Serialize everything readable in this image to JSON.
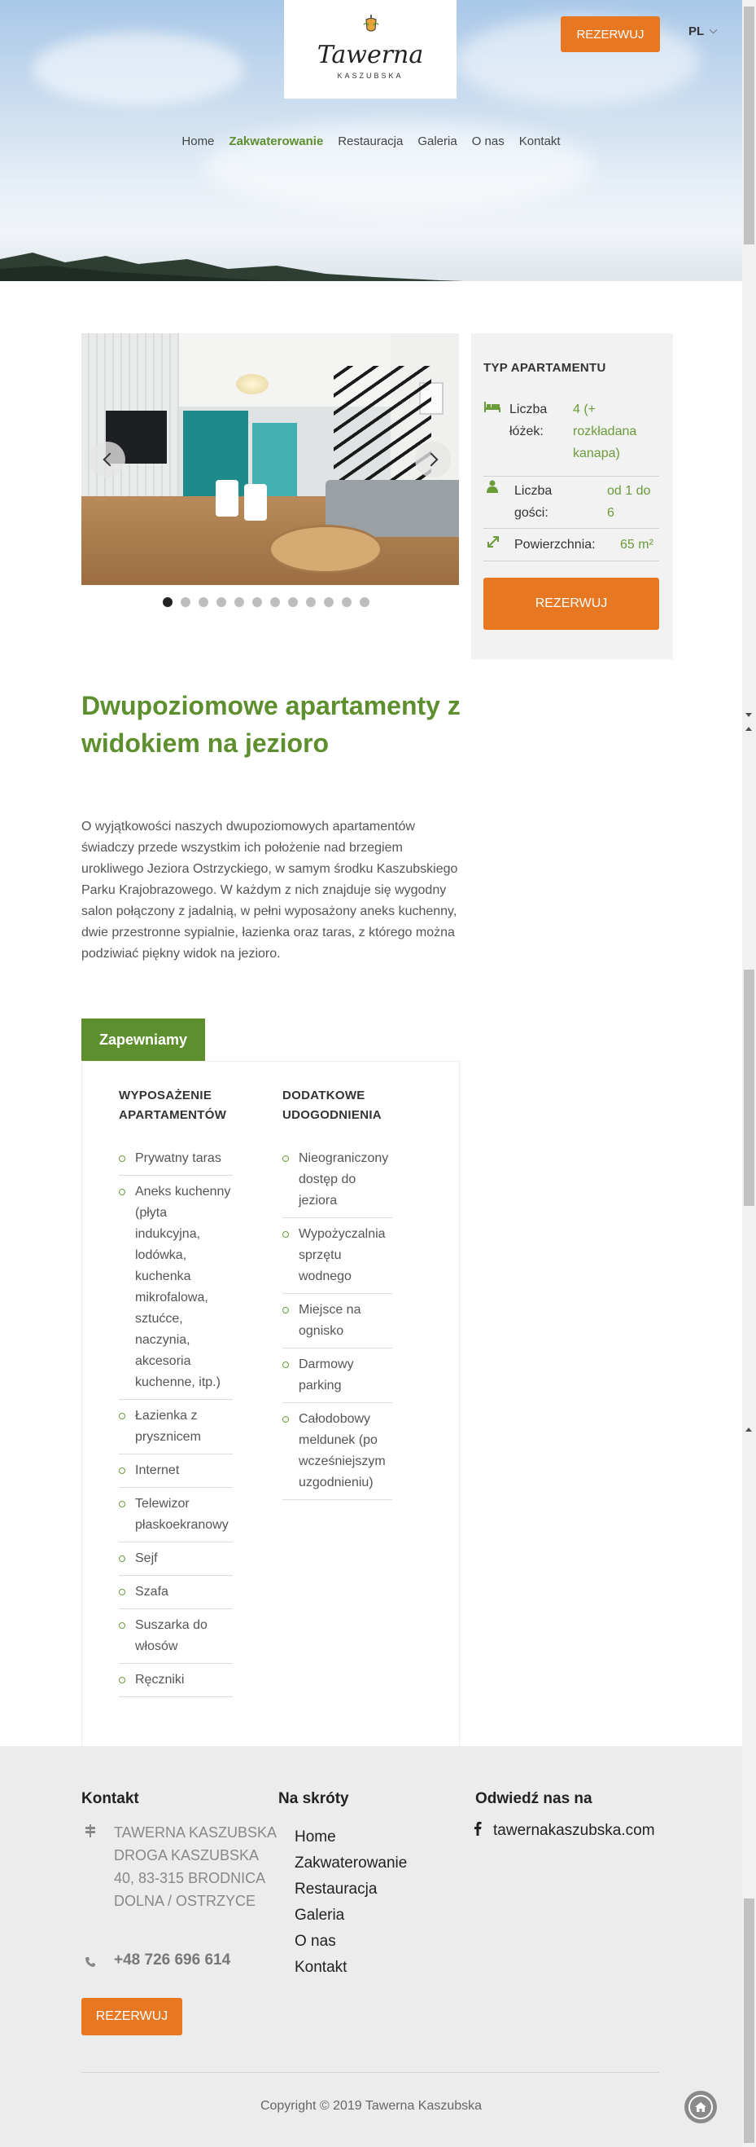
{
  "header": {
    "logo_text": "Tawerna",
    "logo_sub": "KASZUBSKA",
    "reserve_label": "REZERWUJ",
    "lang": "PL",
    "nav": [
      "Home",
      "Zakwaterowanie",
      "Restauracja",
      "Galeria",
      "O nas",
      "Kontakt"
    ],
    "active_nav": "Zakwaterowanie"
  },
  "slider": {
    "dot_count": 12,
    "active_dot": 1
  },
  "info": {
    "title": "TYP APARTAMENTU",
    "rows": [
      {
        "icon": "bed-icon",
        "label": "Liczba łóżek:",
        "value": "4 (+ rozkładana kanapa)"
      },
      {
        "icon": "person-icon",
        "label": "Liczba gości:",
        "value": "od 1 do 6"
      },
      {
        "icon": "resize-icon",
        "label": "Powierzchnia:",
        "value": "65 m²"
      }
    ],
    "reserve_label": "REZERWUJ"
  },
  "main": {
    "title": "Dwupoziomowe apartamenty z widokiem na jezioro",
    "description": "O wyjątkowości naszych dwupoziomowych apartamentów świadczy przede wszystkim ich położenie nad brzegiem urokliwego Jeziora Ostrzyckiego, w samym środku Kaszubskiego Parku Krajobrazowego. W każdym z nich znajduje się wygodny salon połączony z jadalnią, w pełni wyposażony aneks kuchenny, dwie przestronne sypialnie, łazienka oraz taras, z którego można podziwiać piękny widok na jezioro."
  },
  "tabs": {
    "active_label": "Zapewniamy",
    "col1_title": "WYPOSAŻENIE APARTAMENTÓW",
    "col1_items": [
      "Prywatny taras",
      "Aneks kuchenny (płyta indukcyjna, lodówka, kuchenka mikrofalowa, sztućce, naczynia, akcesoria kuchenne, itp.)",
      "Łazienka z prysznicem",
      "Internet",
      "Telewizor płaskoekranowy",
      "Sejf",
      "Szafa",
      "Suszarka do włosów",
      "Ręczniki"
    ],
    "col2_title": "DODATKOWE UDOGODNIENIA",
    "col2_items": [
      "Nieograniczony dostęp do jeziora",
      "Wypożyczalnia sprzętu wodnego",
      "Miejsce na ognisko",
      "Darmowy parking",
      "Całodobowy meldunek (po wcześniejszym uzgodnieniu)"
    ]
  },
  "footer": {
    "contact_title": "Kontakt",
    "address": "TAWERNA KASZUBSKA DROGA KASZUBSKA 40, 83-315 BRODNICA DOLNA / OSTRZYCE",
    "phone": "+48 726 696 614",
    "reserve_label": "REZERWUJ",
    "shortcuts_title": "Na skróty",
    "shortcuts": [
      "Home",
      "Zakwaterowanie",
      "Restauracja",
      "Galeria",
      "O nas",
      "Kontakt"
    ],
    "visit_title": "Odwiedź nas na",
    "facebook": "tawernakaszubska.com",
    "copyright": "Copyright © 2019 Tawerna Kaszubska"
  },
  "colors": {
    "accent_orange": "#e87722",
    "accent_green": "#5d8f2e"
  }
}
